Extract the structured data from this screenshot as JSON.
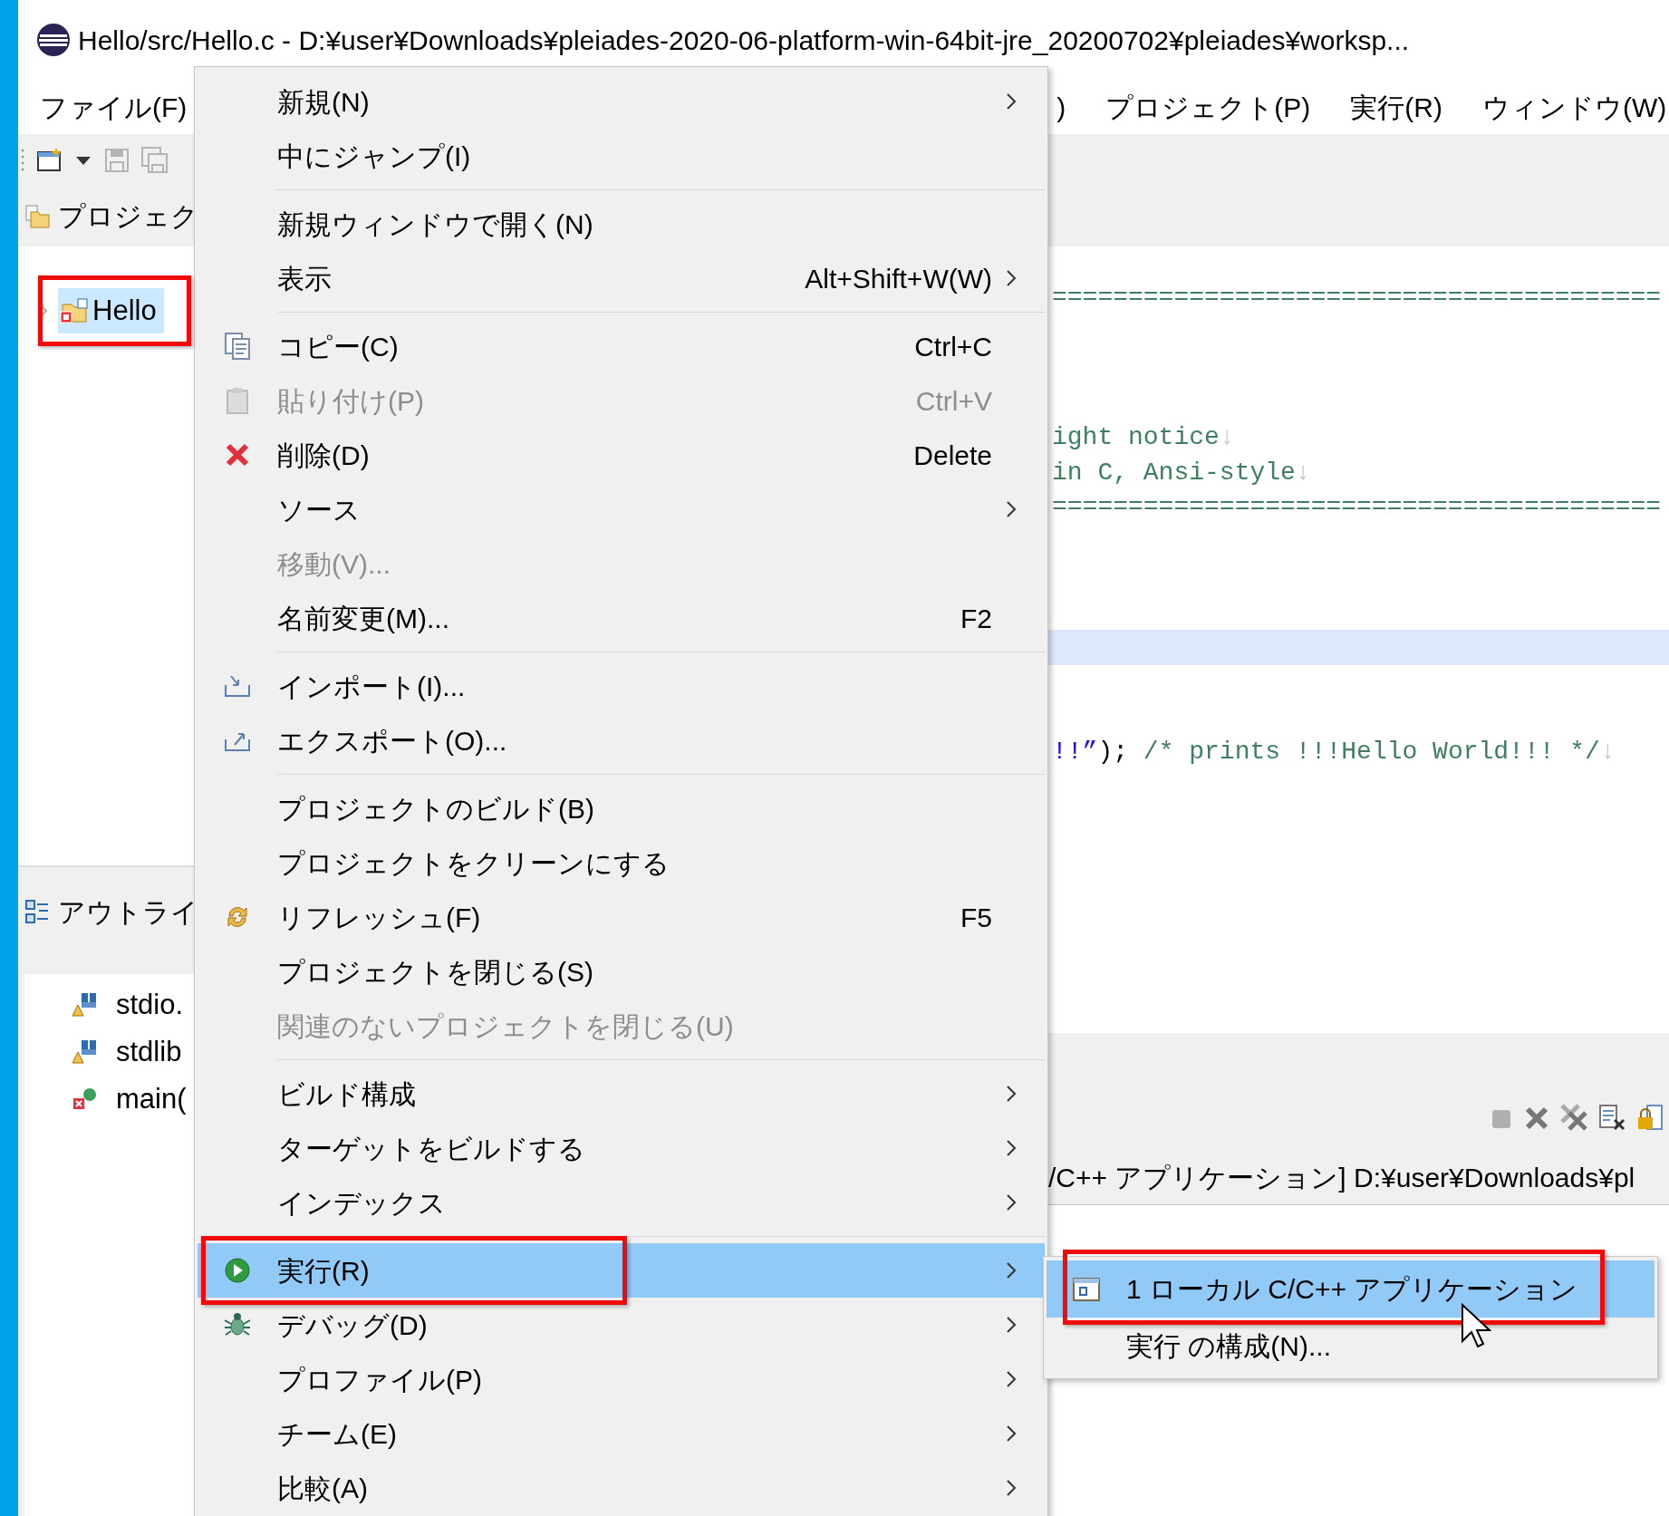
{
  "window": {
    "title": "Hello/src/Hello.c - D:¥user¥Downloads¥pleiades-2020-06-platform-win-64bit-jre_20200702¥pleiades¥worksp..."
  },
  "menubar": [
    {
      "label": "ファイル(F)"
    },
    {
      "label": ")"
    },
    {
      "label": "プロジェクト(P)"
    },
    {
      "label": "実行(R)"
    },
    {
      "label": "ウィンドウ(W)"
    }
  ],
  "toolbar": [
    {
      "kind": "new",
      "disabled": false
    },
    {
      "kind": "dropdown",
      "disabled": false
    },
    {
      "kind": "save",
      "disabled": true
    },
    {
      "kind": "save_all",
      "disabled": true
    }
  ],
  "project_explorer": {
    "title": "プロジェク",
    "items": [
      {
        "label": "Hello",
        "selected": true,
        "expanded": false,
        "highlighted": true
      }
    ]
  },
  "outline": {
    "title": "アウトライ",
    "items": [
      {
        "label": "stdio.",
        "kind": "include"
      },
      {
        "label": "stdlib",
        "kind": "include"
      },
      {
        "label": "main(",
        "kind": "function"
      }
    ]
  },
  "editor": {
    "lines": [
      {
        "current": false,
        "segments": [
          {
            "text": "========================================",
            "kind": "comment"
          }
        ]
      },
      {
        "current": false
      },
      {
        "current": false
      },
      {
        "current": false
      },
      {
        "current": false,
        "segments": [
          {
            "text": "ight notice",
            "kind": "comment"
          }
        ],
        "eol": "↓"
      },
      {
        "current": false,
        "segments": [
          {
            "text": "in C, Ansi-style",
            "kind": "comment"
          }
        ],
        "eol": "↓"
      },
      {
        "current": false,
        "segments": [
          {
            "text": "========================================",
            "kind": "comment"
          }
        ]
      },
      {
        "current": false
      },
      {
        "current": false
      },
      {
        "current": false
      },
      {
        "current": true
      },
      {
        "current": false
      },
      {
        "current": false
      },
      {
        "current": false,
        "segments": [
          {
            "text": "!!”",
            "kind": "string"
          },
          {
            "text": ");",
            "kind": "code"
          },
          {
            "text": " /* prints !!!Hello World!!! */",
            "kind": "comment"
          }
        ],
        "eol": "↓"
      }
    ]
  },
  "console": {
    "label": "/C++ アプリケーション] D:¥user¥Downloads¥pl",
    "toolbar": [
      {
        "kind": "terminate",
        "disabled": true
      },
      {
        "kind": "remove",
        "disabled": false
      },
      {
        "kind": "remove_all",
        "disabled": false
      },
      {
        "kind": "clear",
        "disabled": false
      },
      {
        "kind": "scroll_lock",
        "disabled": false
      }
    ]
  },
  "context_menu": {
    "items": [
      {
        "kind": "item",
        "label": "新規(N)",
        "submenu": true,
        "disabled": false,
        "selected": false,
        "highlighted": false
      },
      {
        "kind": "item",
        "label": "中にジャンプ(I)",
        "submenu": false,
        "disabled": false,
        "selected": false,
        "highlighted": false
      },
      {
        "kind": "separator"
      },
      {
        "kind": "item",
        "label": "新規ウィンドウで開く(N)",
        "submenu": false,
        "disabled": false,
        "selected": false,
        "highlighted": false
      },
      {
        "kind": "item",
        "label": "表示",
        "shortcut": "Alt+Shift+W(W)",
        "submenu": true,
        "disabled": false,
        "selected": false,
        "highlighted": false
      },
      {
        "kind": "separator"
      },
      {
        "kind": "copy",
        "label": "コピー(C)",
        "shortcut": "Ctrl+C",
        "submenu": false,
        "disabled": false,
        "selected": false,
        "highlighted": false
      },
      {
        "kind": "paste",
        "label": "貼り付け(P)",
        "shortcut": "Ctrl+V",
        "submenu": false,
        "disabled": true,
        "selected": false,
        "highlighted": false
      },
      {
        "kind": "delete",
        "label": "削除(D)",
        "shortcut": "Delete",
        "submenu": false,
        "disabled": false,
        "selected": false,
        "highlighted": false
      },
      {
        "kind": "item",
        "label": "ソース",
        "submenu": true,
        "disabled": false,
        "selected": false,
        "highlighted": false
      },
      {
        "kind": "item",
        "label": "移動(V)...",
        "submenu": false,
        "disabled": true,
        "selected": false,
        "highlighted": false
      },
      {
        "kind": "item",
        "label": "名前変更(M)...",
        "shortcut": "F2",
        "submenu": false,
        "disabled": false,
        "selected": false,
        "highlighted": false
      },
      {
        "kind": "separator"
      },
      {
        "kind": "import",
        "label": "インポート(I)...",
        "submenu": false,
        "disabled": false,
        "selected": false,
        "highlighted": false
      },
      {
        "kind": "export",
        "label": "エクスポート(O)...",
        "submenu": false,
        "disabled": false,
        "selected": false,
        "highlighted": false
      },
      {
        "kind": "separator"
      },
      {
        "kind": "item",
        "label": "プロジェクトのビルド(B)",
        "submenu": false,
        "disabled": false,
        "selected": false,
        "highlighted": false
      },
      {
        "kind": "item",
        "label": "プロジェクトをクリーンにする",
        "submenu": false,
        "disabled": false,
        "selected": false,
        "highlighted": false
      },
      {
        "kind": "refresh",
        "label": "リフレッシュ(F)",
        "shortcut": "F5",
        "submenu": false,
        "disabled": false,
        "selected": false,
        "highlighted": false
      },
      {
        "kind": "item",
        "label": "プロジェクトを閉じる(S)",
        "submenu": false,
        "disabled": false,
        "selected": false,
        "highlighted": false
      },
      {
        "kind": "item",
        "label": "関連のないプロジェクトを閉じる(U)",
        "submenu": false,
        "disabled": true,
        "selected": false,
        "highlighted": false
      },
      {
        "kind": "separator"
      },
      {
        "kind": "item",
        "label": "ビルド構成",
        "submenu": true,
        "disabled": false,
        "selected": false,
        "highlighted": false
      },
      {
        "kind": "item",
        "label": "ターゲットをビルドする",
        "submenu": true,
        "disabled": false,
        "selected": false,
        "highlighted": false
      },
      {
        "kind": "item",
        "label": "インデックス",
        "submenu": true,
        "disabled": false,
        "selected": false,
        "highlighted": false
      },
      {
        "kind": "separator"
      },
      {
        "kind": "run",
        "label": "実行(R)",
        "submenu": true,
        "disabled": false,
        "selected": true,
        "highlighted": true
      },
      {
        "kind": "debug",
        "label": "デバッグ(D)",
        "submenu": true,
        "disabled": false,
        "selected": false,
        "highlighted": false
      },
      {
        "kind": "item",
        "label": "プロファイル(P)",
        "submenu": true,
        "disabled": false,
        "selected": false,
        "highlighted": false
      },
      {
        "kind": "item",
        "label": "チーム(E)",
        "submenu": true,
        "disabled": false,
        "selected": false,
        "highlighted": false
      },
      {
        "kind": "item",
        "label": "比較(A)",
        "submenu": true,
        "disabled": false,
        "selected": false,
        "highlighted": false
      }
    ]
  },
  "submenu": {
    "items": [
      {
        "kind": "app",
        "label": "1 ローカル C/C++ アプリケーション",
        "selected": true,
        "highlighted": true
      },
      {
        "kind": "item",
        "label": "実行 の構成(N)...",
        "selected": false,
        "highlighted": false
      }
    ]
  }
}
